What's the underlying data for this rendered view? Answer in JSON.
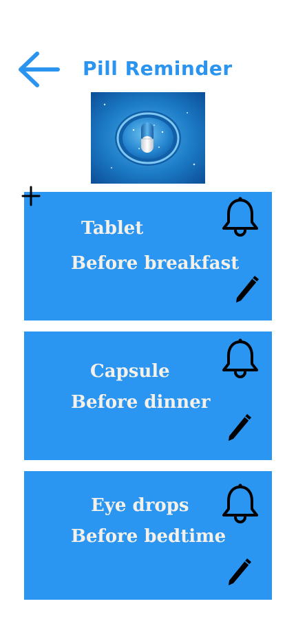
{
  "header": {
    "title": "Pill Reminder",
    "back_icon": "arrow-left-icon"
  },
  "colors": {
    "accent": "#2a94ee",
    "card_background": "#2b95f2",
    "card_text": "#f4f1ea",
    "icon": "#000000"
  },
  "toolbar": {
    "add_icon": "plus-icon"
  },
  "reminders": [
    {
      "name": "Tablet",
      "time": "Before breakfast",
      "bell_icon": "bell-icon",
      "edit_icon": "pencil-icon"
    },
    {
      "name": "Capsule",
      "time": "Before dinner",
      "bell_icon": "bell-icon",
      "edit_icon": "pencil-icon"
    },
    {
      "name": "Eye drops",
      "time": "Before bedtime",
      "bell_icon": "bell-icon",
      "edit_icon": "pencil-icon"
    }
  ]
}
